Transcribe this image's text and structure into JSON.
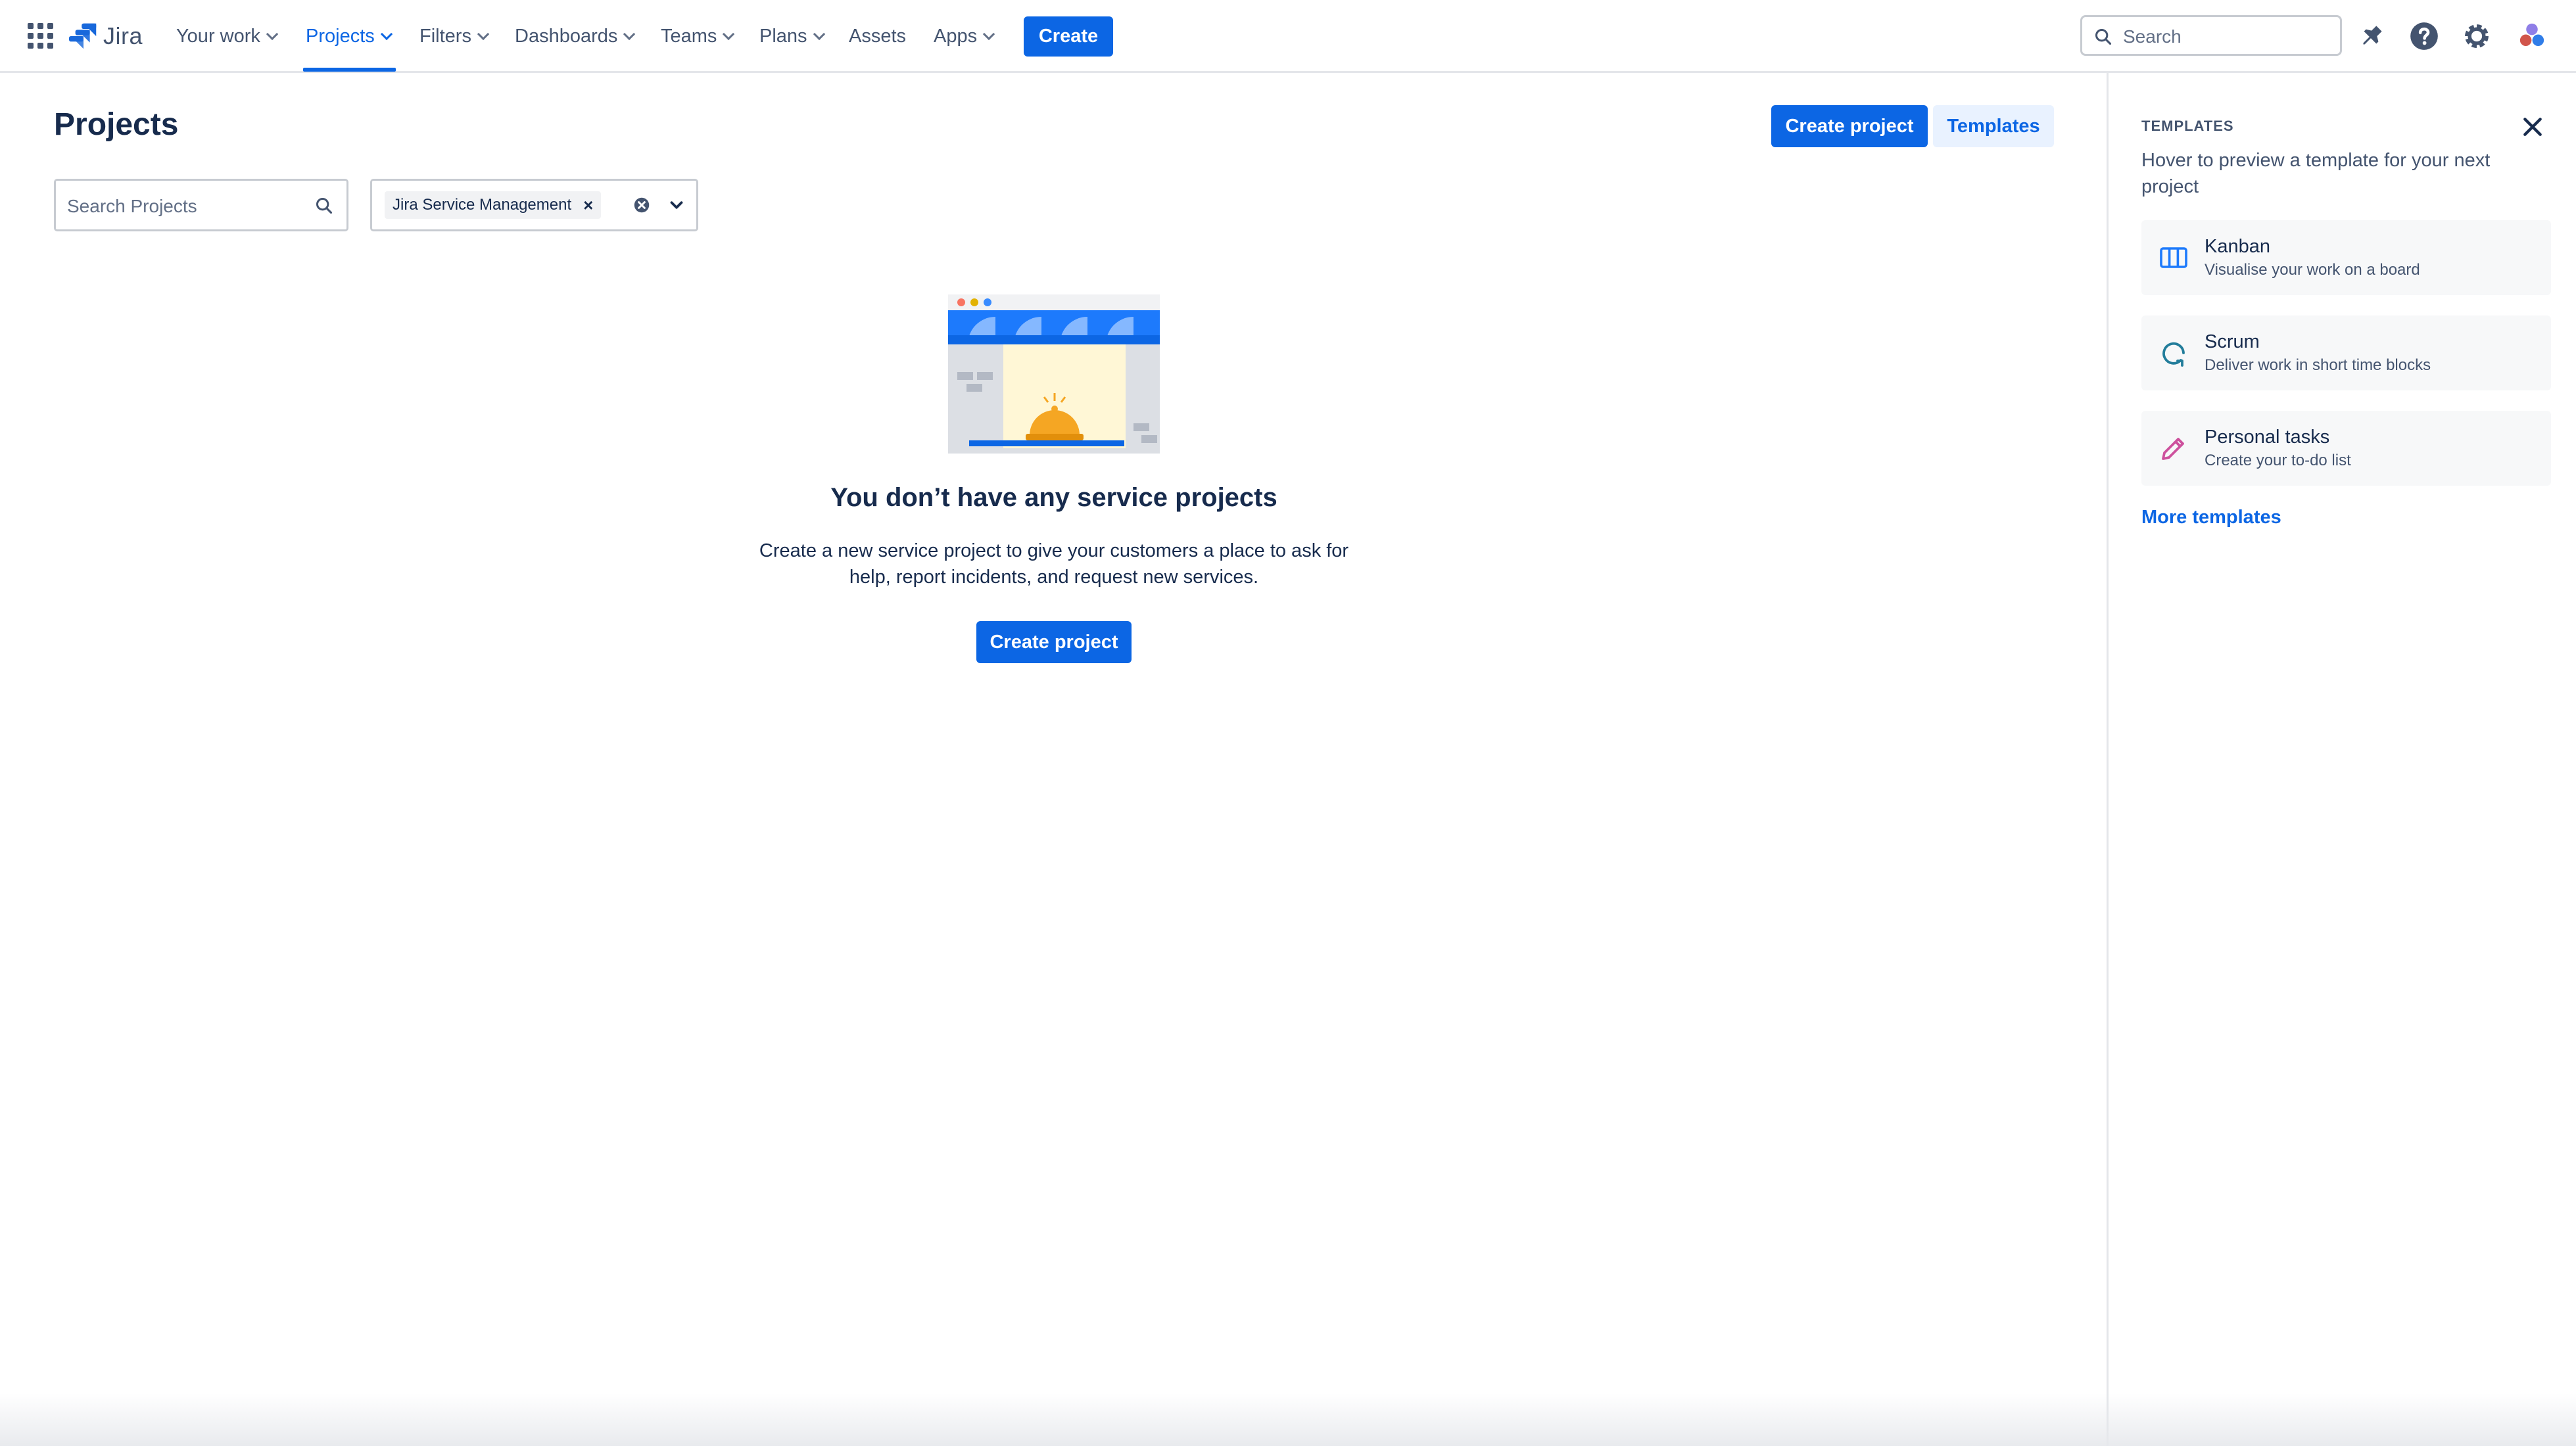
{
  "nav": {
    "logo_text": "Jira",
    "items": [
      {
        "label": "Your work"
      },
      {
        "label": "Projects"
      },
      {
        "label": "Filters"
      },
      {
        "label": "Dashboards"
      },
      {
        "label": "Teams"
      },
      {
        "label": "Plans"
      },
      {
        "label": "Assets"
      },
      {
        "label": "Apps"
      }
    ],
    "active_item": "Projects",
    "create_label": "Create",
    "search_placeholder": "Search",
    "icons": [
      "app-switcher-icon",
      "jira-logo-icon",
      "notifications-icon",
      "help-icon",
      "settings-icon",
      "profile-avatar"
    ]
  },
  "page": {
    "title": "Projects",
    "create_project_label": "Create project",
    "templates_label": "Templates"
  },
  "filters": {
    "search_placeholder": "Search Projects",
    "product_chip": "Jira Service Management",
    "chip_remove": "×"
  },
  "empty_state": {
    "title": "You don’t have any service projects",
    "description_line1": "Create a new service project to give your customers a place to ask for",
    "description_line2": "help, report incidents, and request new services.",
    "button_label": "Create project"
  },
  "templates_panel": {
    "heading": "TEMPLATES",
    "subtitle": "Hover to preview a template for your next project",
    "items": [
      {
        "name": "Kanban",
        "description": "Visualise your work on a board",
        "icon": "kanban-board-icon"
      },
      {
        "name": "Scrum",
        "description": "Deliver work in short time blocks",
        "icon": "scrum-cycle-icon"
      },
      {
        "name": "Personal tasks",
        "description": "Create your to-do list",
        "icon": "pencil-icon"
      }
    ],
    "more_label": "More templates"
  },
  "colors": {
    "brand_blue": "#0C66E4",
    "text": "#172B4D",
    "subtle_text": "#44546F",
    "subtle_button_bg": "#E9F2FF"
  }
}
